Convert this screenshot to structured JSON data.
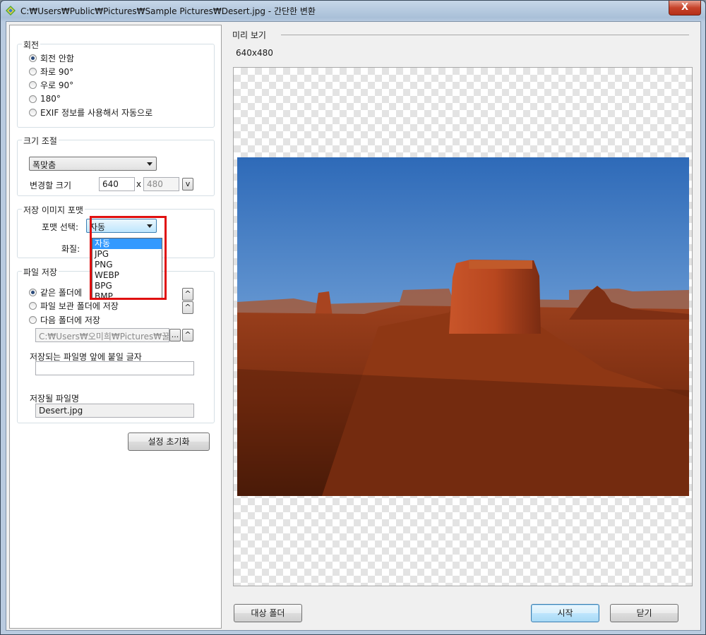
{
  "window": {
    "title": "C:₩Users₩Public₩Pictures₩Sample Pictures₩Desert.jpg - 간단한 변환",
    "close_label": "X"
  },
  "rotation": {
    "title": "회전",
    "options": [
      "회전 안함",
      "좌로 90°",
      "우로 90°",
      "180°",
      "EXIF 정보를 사용해서 자동으로"
    ],
    "selected_index": 0
  },
  "resize": {
    "title": "크기 조절",
    "mode": "폭맞춤",
    "size_label": "변경할 크기",
    "width": "640",
    "separator": "x",
    "height": "480",
    "toggle_label": "v"
  },
  "format": {
    "title": "저장 이미지 포맷",
    "select_label": "포맷 선택:",
    "selected": "자동",
    "quality_label": "화질:",
    "options": [
      "자동",
      "JPG",
      "PNG",
      "WEBP",
      "BPG",
      "BMP"
    ],
    "highlighted_index": 0
  },
  "save": {
    "title": "파일 저장",
    "options": [
      "같은 폴더에",
      "파일 보관 폴더에 저장",
      "다음 폴더에 저장"
    ],
    "selected_index": 0,
    "folder_path": "C:₩Users₩오미희₩Pictures₩꿀뷰",
    "browse_label": "...",
    "up_label": "^",
    "prefix_label": "저장되는 파일명 앞에 붙일 글자",
    "prefix_value": "",
    "filename_label": "저장될 파일명",
    "filename_value": "Desert.jpg"
  },
  "reset_button": "설정 초기화",
  "preview": {
    "label": "미리 보기",
    "size_text": "640x480"
  },
  "footer": {
    "target_folder": "대상 폴더",
    "start": "시작",
    "close": "닫기"
  }
}
